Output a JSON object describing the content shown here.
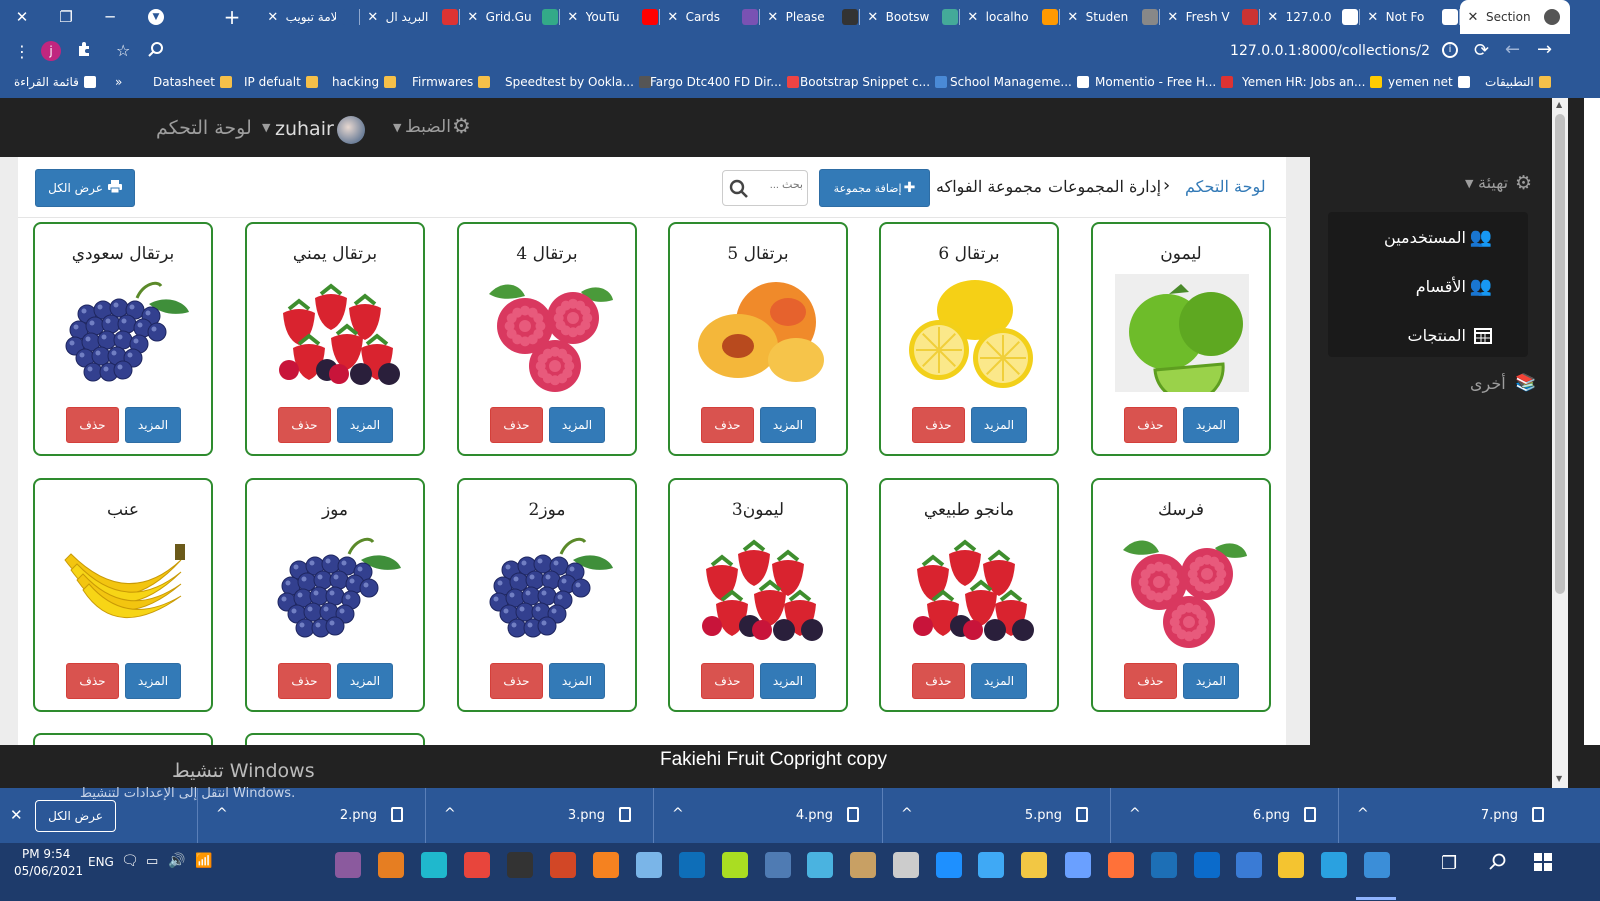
{
  "browser": {
    "tabs": [
      {
        "title": "Section",
        "fav": "#555"
      },
      {
        "title": "Not Fo",
        "fav": "#fff"
      },
      {
        "title": "127.0.0",
        "fav": "#fff"
      },
      {
        "title": "Fresh V",
        "fav": "#c33"
      },
      {
        "title": "Studen",
        "fav": "#888"
      },
      {
        "title": "localho",
        "fav": "#f90"
      },
      {
        "title": "Bootsw",
        "fav": "#4a9"
      },
      {
        "title": "Please",
        "fav": "#333"
      },
      {
        "title": "Cards",
        "fav": "#7952b3"
      },
      {
        "title": "YouTu",
        "fav": "#f00"
      },
      {
        "title": "Grid.Gu",
        "fav": "#3a8"
      },
      {
        "title": "البريد ال",
        "fav": "#d33"
      },
      {
        "title": "علامة تبويب",
        "fav": "#2b5797"
      }
    ],
    "url": "127.0.0.1:8000/collections/2",
    "profile_letter": "j",
    "bookmarks": [
      {
        "label": "التطبيقات",
        "color": "#f5c04a"
      },
      {
        "label": "yemen net",
        "color": "#fff"
      },
      {
        "label": "Yemen HR: Jobs an...",
        "color": "#fc0"
      },
      {
        "label": "Momentio - Free H...",
        "color": "#d33"
      },
      {
        "label": "School Manageme...",
        "color": "#fff"
      },
      {
        "label": "Bootstrap Snippet c...",
        "color": "#4a8ad6"
      },
      {
        "label": "Fargo Dtc400 FD Dir...",
        "color": "#e44"
      },
      {
        "label": "Speedtest by Ookla...",
        "color": "#555"
      },
      {
        "label": "Firmwares",
        "color": "#f5c04a"
      },
      {
        "label": "hacking",
        "color": "#f5c04a"
      },
      {
        "label": "IP defualt",
        "color": "#f5c04a"
      },
      {
        "label": "Datasheet",
        "color": "#f5c04a"
      },
      {
        "label": "»",
        "color": ""
      },
      {
        "label": "قائمة القراءة",
        "color": "#fff"
      }
    ]
  },
  "navbar": {
    "brand": "لوحة التحكم",
    "user": "zuhair",
    "settings": "الضبط"
  },
  "sidebar": {
    "setup": "تهيئة",
    "items": [
      "المستخدمين",
      "الأقسام",
      "المنتجات"
    ],
    "other": "أخرى"
  },
  "header": {
    "breadcrumb_home": "لوحة التحكم",
    "breadcrumb_current": "إدارة المجموعات",
    "collection_name": "مجموعة الفواكه",
    "add_button": "إضافة مجموعة",
    "search_placeholder": "بحث ...",
    "print_button": "عرض الكل"
  },
  "cards": [
    {
      "title": "ليمون",
      "fruit": "lime"
    },
    {
      "title": "برتقال 6",
      "fruit": "lemon"
    },
    {
      "title": "برتقال 5",
      "fruit": "peach"
    },
    {
      "title": "برتقال 4",
      "fruit": "raspberry"
    },
    {
      "title": "برتقال يمني",
      "fruit": "berries"
    },
    {
      "title": "برتقال سعودي",
      "fruit": "grapes"
    },
    {
      "title": "فرسك",
      "fruit": "raspberry"
    },
    {
      "title": "مانجو طبيعي",
      "fruit": "berries"
    },
    {
      "title": "ليمون3",
      "fruit": "berries"
    },
    {
      "title": "موز2",
      "fruit": "grapes"
    },
    {
      "title": "موز",
      "fruit": "grapes"
    },
    {
      "title": "عنب",
      "fruit": "banana"
    }
  ],
  "card_buttons": {
    "more": "المزيد",
    "delete": "حذف"
  },
  "footer": {
    "copyright": "Fakiehi Fruit Copright copy",
    "activate_title": "تنشيط Windows",
    "activate_sub": "انتقل إلى الإعدادات لتنشيط Windows."
  },
  "downloads": {
    "show_all": "عرض الكل",
    "files": [
      "7.png",
      "6.png",
      "5.png",
      "4.png",
      "3.png",
      "2.png"
    ]
  },
  "taskbar": {
    "time": "PM 9:54",
    "date": "05/06/2021",
    "lang": "ENG"
  },
  "colors": {
    "chrome": "#2b5797",
    "navbar": "#222222",
    "primary": "#337ab7",
    "danger": "#d9534f",
    "card_border": "#2e8b2e"
  }
}
